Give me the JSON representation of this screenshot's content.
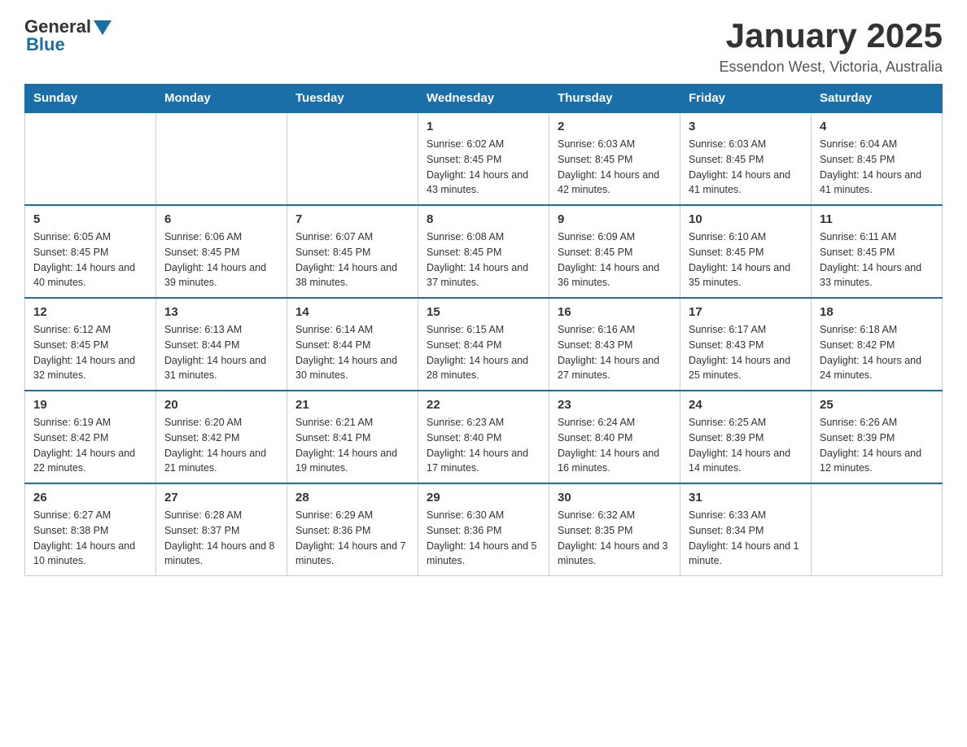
{
  "header": {
    "logo": {
      "general": "General",
      "blue": "Blue"
    },
    "title": "January 2025",
    "subtitle": "Essendon West, Victoria, Australia"
  },
  "calendar": {
    "days_of_week": [
      "Sunday",
      "Monday",
      "Tuesday",
      "Wednesday",
      "Thursday",
      "Friday",
      "Saturday"
    ],
    "weeks": [
      [
        {
          "day": "",
          "info": ""
        },
        {
          "day": "",
          "info": ""
        },
        {
          "day": "",
          "info": ""
        },
        {
          "day": "1",
          "info": "Sunrise: 6:02 AM\nSunset: 8:45 PM\nDaylight: 14 hours and 43 minutes."
        },
        {
          "day": "2",
          "info": "Sunrise: 6:03 AM\nSunset: 8:45 PM\nDaylight: 14 hours and 42 minutes."
        },
        {
          "day": "3",
          "info": "Sunrise: 6:03 AM\nSunset: 8:45 PM\nDaylight: 14 hours and 41 minutes."
        },
        {
          "day": "4",
          "info": "Sunrise: 6:04 AM\nSunset: 8:45 PM\nDaylight: 14 hours and 41 minutes."
        }
      ],
      [
        {
          "day": "5",
          "info": "Sunrise: 6:05 AM\nSunset: 8:45 PM\nDaylight: 14 hours and 40 minutes."
        },
        {
          "day": "6",
          "info": "Sunrise: 6:06 AM\nSunset: 8:45 PM\nDaylight: 14 hours and 39 minutes."
        },
        {
          "day": "7",
          "info": "Sunrise: 6:07 AM\nSunset: 8:45 PM\nDaylight: 14 hours and 38 minutes."
        },
        {
          "day": "8",
          "info": "Sunrise: 6:08 AM\nSunset: 8:45 PM\nDaylight: 14 hours and 37 minutes."
        },
        {
          "day": "9",
          "info": "Sunrise: 6:09 AM\nSunset: 8:45 PM\nDaylight: 14 hours and 36 minutes."
        },
        {
          "day": "10",
          "info": "Sunrise: 6:10 AM\nSunset: 8:45 PM\nDaylight: 14 hours and 35 minutes."
        },
        {
          "day": "11",
          "info": "Sunrise: 6:11 AM\nSunset: 8:45 PM\nDaylight: 14 hours and 33 minutes."
        }
      ],
      [
        {
          "day": "12",
          "info": "Sunrise: 6:12 AM\nSunset: 8:45 PM\nDaylight: 14 hours and 32 minutes."
        },
        {
          "day": "13",
          "info": "Sunrise: 6:13 AM\nSunset: 8:44 PM\nDaylight: 14 hours and 31 minutes."
        },
        {
          "day": "14",
          "info": "Sunrise: 6:14 AM\nSunset: 8:44 PM\nDaylight: 14 hours and 30 minutes."
        },
        {
          "day": "15",
          "info": "Sunrise: 6:15 AM\nSunset: 8:44 PM\nDaylight: 14 hours and 28 minutes."
        },
        {
          "day": "16",
          "info": "Sunrise: 6:16 AM\nSunset: 8:43 PM\nDaylight: 14 hours and 27 minutes."
        },
        {
          "day": "17",
          "info": "Sunrise: 6:17 AM\nSunset: 8:43 PM\nDaylight: 14 hours and 25 minutes."
        },
        {
          "day": "18",
          "info": "Sunrise: 6:18 AM\nSunset: 8:42 PM\nDaylight: 14 hours and 24 minutes."
        }
      ],
      [
        {
          "day": "19",
          "info": "Sunrise: 6:19 AM\nSunset: 8:42 PM\nDaylight: 14 hours and 22 minutes."
        },
        {
          "day": "20",
          "info": "Sunrise: 6:20 AM\nSunset: 8:42 PM\nDaylight: 14 hours and 21 minutes."
        },
        {
          "day": "21",
          "info": "Sunrise: 6:21 AM\nSunset: 8:41 PM\nDaylight: 14 hours and 19 minutes."
        },
        {
          "day": "22",
          "info": "Sunrise: 6:23 AM\nSunset: 8:40 PM\nDaylight: 14 hours and 17 minutes."
        },
        {
          "day": "23",
          "info": "Sunrise: 6:24 AM\nSunset: 8:40 PM\nDaylight: 14 hours and 16 minutes."
        },
        {
          "day": "24",
          "info": "Sunrise: 6:25 AM\nSunset: 8:39 PM\nDaylight: 14 hours and 14 minutes."
        },
        {
          "day": "25",
          "info": "Sunrise: 6:26 AM\nSunset: 8:39 PM\nDaylight: 14 hours and 12 minutes."
        }
      ],
      [
        {
          "day": "26",
          "info": "Sunrise: 6:27 AM\nSunset: 8:38 PM\nDaylight: 14 hours and 10 minutes."
        },
        {
          "day": "27",
          "info": "Sunrise: 6:28 AM\nSunset: 8:37 PM\nDaylight: 14 hours and 8 minutes."
        },
        {
          "day": "28",
          "info": "Sunrise: 6:29 AM\nSunset: 8:36 PM\nDaylight: 14 hours and 7 minutes."
        },
        {
          "day": "29",
          "info": "Sunrise: 6:30 AM\nSunset: 8:36 PM\nDaylight: 14 hours and 5 minutes."
        },
        {
          "day": "30",
          "info": "Sunrise: 6:32 AM\nSunset: 8:35 PM\nDaylight: 14 hours and 3 minutes."
        },
        {
          "day": "31",
          "info": "Sunrise: 6:33 AM\nSunset: 8:34 PM\nDaylight: 14 hours and 1 minute."
        },
        {
          "day": "",
          "info": ""
        }
      ]
    ]
  }
}
